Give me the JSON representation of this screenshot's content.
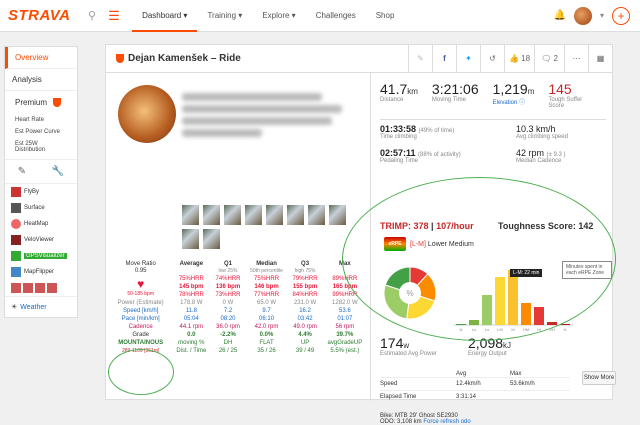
{
  "nav": {
    "logo": "STRAVA",
    "items": [
      {
        "label": "Dashboard",
        "active": true
      },
      {
        "label": "Training",
        "active": false
      },
      {
        "label": "Explore",
        "active": false
      },
      {
        "label": "Challenges",
        "active": false
      },
      {
        "label": "Shop",
        "active": false
      }
    ],
    "search_icon": "search-icon",
    "menu_icon": "menu-icon",
    "bell_icon": "bell-icon",
    "plus_icon": "plus-icon"
  },
  "sidebar": {
    "items": [
      {
        "label": "Overview",
        "active": true
      },
      {
        "label": "Analysis",
        "active": false
      }
    ],
    "premium_label": "Premium",
    "premium_subitems": [
      "Heart Rate",
      "Est Power Curve",
      "Est 25W Distribution"
    ],
    "tools": [
      "pencil-icon",
      "wrench-icon"
    ],
    "extensions": [
      {
        "label": "FlyBy",
        "icon": "flyby-icon"
      },
      {
        "label": "Surface",
        "icon": "surface-icon"
      },
      {
        "label": "HeatMap",
        "icon": "heatmap-icon"
      },
      {
        "label": "VeloViewer",
        "icon": "veloviewer-icon"
      },
      {
        "label": "GPSVisualizer",
        "icon": "gps-icon"
      },
      {
        "label": "MapFlipper",
        "icon": "mapflipper-icon"
      }
    ],
    "weather_label": "Weather"
  },
  "activity": {
    "title": "Dejan Kamenšek – Ride",
    "kudos_count": "18",
    "comments_count": "2"
  },
  "stats_table": {
    "headers": [
      "Move Ratio",
      "Average",
      "Q1",
      "Median",
      "Q3",
      "Max"
    ],
    "subheaders": [
      "",
      "",
      "low 25%",
      "50th percentile",
      "high 75%",
      ""
    ],
    "move_ratio": "0.95",
    "hr_label": "50-185 bpm",
    "hr_rows": [
      [
        "75%HRR",
        "74%HRR",
        "75%HRR",
        "79%HRR",
        "89%HRR"
      ],
      [
        "145 bpm",
        "136 bpm",
        "146 bpm",
        "155 bpm",
        "165 bpm"
      ],
      [
        "78%HRR",
        "73%HRR",
        "77%HRR",
        "84%HRR",
        "99%HRR"
      ]
    ],
    "power": [
      "Power (Estimate)",
      "178.8 W",
      "0 W",
      "65.0 W",
      "231.0 W",
      "1282.0 W"
    ],
    "speed": [
      "Speed [km/h]",
      "11.8",
      "7.2",
      "9.7",
      "16.2",
      "53.6"
    ],
    "pace": [
      "Pace [min/km]",
      "05:04",
      "08:20",
      "06:10",
      "03:42",
      "01:07"
    ],
    "cadence": [
      "Cadence",
      "44.1 rpm",
      "36.0 rpm",
      "42.0 rpm",
      "49.0 rpm",
      "56 rpm"
    ],
    "grade": [
      "Grade",
      "0.0",
      "-2.2%",
      "0.0%",
      "4.4%",
      "39.7%"
    ],
    "terrain": "MOUNTAINOUS",
    "terrain_range": "289-1109 [361m]",
    "moving_labels": [
      "moving %",
      "DH",
      "FLAT",
      "UP",
      "avgGradeUP"
    ],
    "moving_values": [
      "Dist. / Time",
      "26 / 25",
      "35 / 26",
      "39 / 49",
      "5.5% (est.)"
    ]
  },
  "summary": {
    "distance": "41.7",
    "distance_unit": "km",
    "distance_label": "Distance",
    "moving_time": "3:21:06",
    "moving_time_label": "Moving Time",
    "elevation": "1,219",
    "elevation_unit": "m",
    "elevation_label": "Elevation",
    "suffer": "145",
    "suffer_label": "Tough Suffer Score",
    "climbing_time": "01:33:58",
    "climbing_pct": "(49% of time)",
    "climbing_label": "Time climbing",
    "climb_speed": "10.3 km/h",
    "climb_speed_label": "Avg climbing speed",
    "pedaling_time": "02:57:11",
    "pedaling_pct": "(88% of activity)",
    "pedaling_label": "Pedaling Time",
    "cadence": "42 rpm",
    "cadence_q": "(± 9.3 )",
    "cadence_label": "Median Cadence",
    "trimp": "TRIMP:",
    "trimp_val": "378",
    "trimp_rate": "107/hour",
    "toughness": "Toughness Score:",
    "toughness_val": "142",
    "zone_label": "Lower Medium",
    "zone_code": "[L-M]",
    "tooltip": "L-M: 22 min",
    "tipbox": "Minutes spent in each eRPE Zone",
    "power": "174",
    "power_unit": "w",
    "power_label": "Estimated Avg Power",
    "energy": "2,098",
    "energy_unit": "kJ",
    "energy_label": "Energy Output",
    "table_headers": [
      "",
      "Avg",
      "Max"
    ],
    "table_rows": [
      [
        "Speed",
        "12.4km/h",
        "53.6km/h"
      ],
      [
        "Elapsed Time",
        "3:31:14",
        ""
      ]
    ],
    "show_more": "Show More",
    "bike": "Bike: MTB 29' Ghost SE2930",
    "odo": "ODO: 3,108 km",
    "force_refresh": "Force refresh odo"
  },
  "chart_data": {
    "type": "bar",
    "categories": [
      "N",
      "Lo",
      "Lo",
      "LM",
      "M",
      "HM",
      "Hi",
      "VH",
      "H"
    ],
    "values": [
      1,
      5,
      30,
      48,
      55,
      22,
      18,
      3,
      1
    ],
    "pie": [
      {
        "name": "Red",
        "value": 12,
        "color": "#e53935"
      },
      {
        "name": "Orange",
        "value": 18,
        "color": "#fb8c00"
      },
      {
        "name": "Yellow",
        "value": 22,
        "color": "#fdd835"
      },
      {
        "name": "LightGreen",
        "value": 28,
        "color": "#9ccc65"
      },
      {
        "name": "Green",
        "value": 20,
        "color": "#43a047"
      }
    ],
    "bar_colors": [
      "#43a047",
      "#7cb342",
      "#9ccc65",
      "#fdd835",
      "#fbc02d",
      "#fb8c00",
      "#e53935",
      "#c62828",
      "#b71c1c"
    ]
  }
}
